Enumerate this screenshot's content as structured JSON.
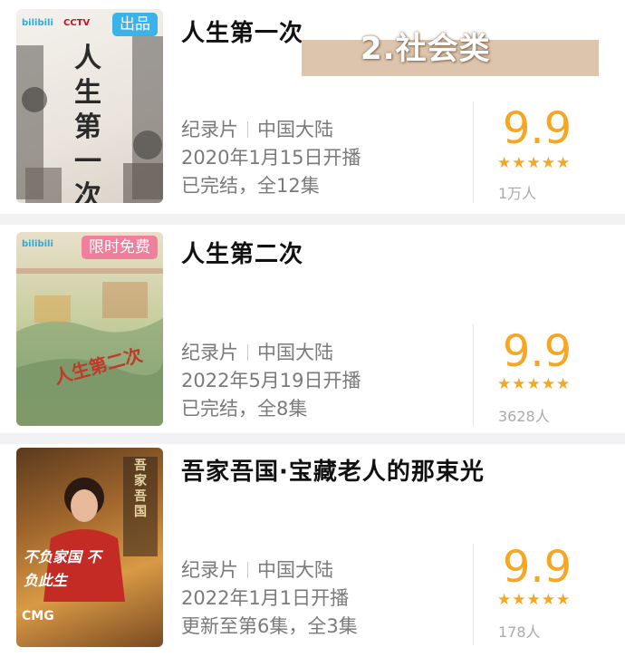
{
  "overlay": {
    "label": "2.社会类"
  },
  "items": [
    {
      "title": "人生第一次",
      "badge": "出品",
      "genre": "纪录片",
      "region": "中国大陆",
      "release": "2020年1月15日开播",
      "status": "已完结，全12集",
      "score": "9.9",
      "stars": "★★★★★",
      "count": "1万人",
      "poster_text": "人生第一次",
      "poster_logo": "bilibili",
      "poster_logo2": "CCTV"
    },
    {
      "title": "人生第二次",
      "badge": "限时免费",
      "genre": "纪录片",
      "region": "中国大陆",
      "release": "2022年5月19日开播",
      "status": "已完结，全8集",
      "score": "9.9",
      "stars": "★★★★★",
      "count": "3628人",
      "poster_text": "人生第二次",
      "poster_logo": "bilibili"
    },
    {
      "title": "吾家吾国·宝藏老人的那束光",
      "genre": "纪录片",
      "region": "中国大陆",
      "release": "2022年1月1日开播",
      "status": "更新至第6集，全3集",
      "score": "9.9",
      "stars": "★★★★★",
      "count": "178人",
      "poster_text": "不负家国 不负此生",
      "poster_side": "吾家吾国",
      "poster_logo": "CMG"
    }
  ],
  "colors": {
    "accent": "#f5a623",
    "badge_blue": "#3ab3e8",
    "badge_pink": "#f07f9c"
  }
}
